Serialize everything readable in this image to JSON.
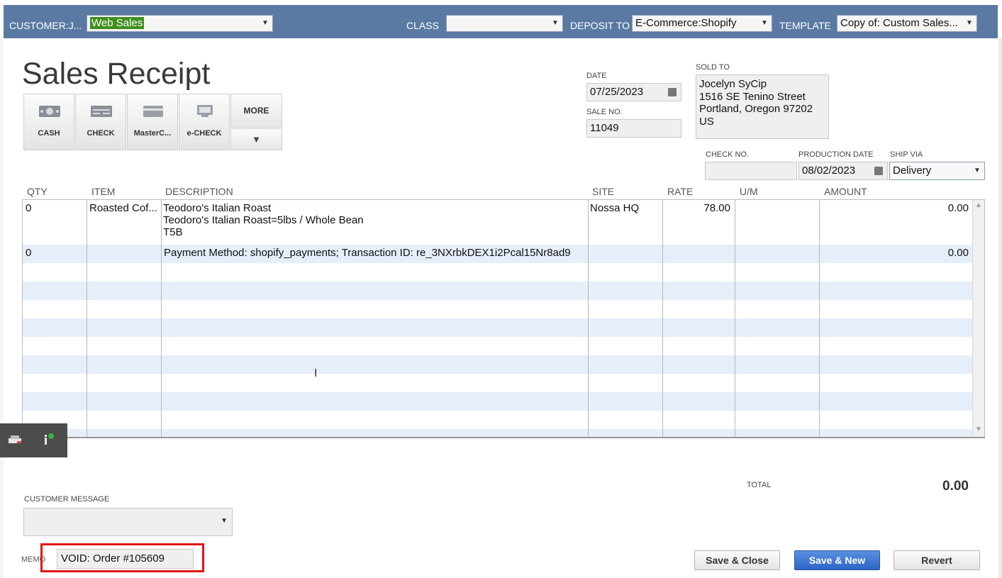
{
  "header": {
    "customer_label": "CUSTOMER:J...",
    "customer_value": "Web Sales",
    "class_label": "CLASS",
    "class_value": "",
    "deposit_label": "DEPOSIT TO",
    "deposit_value": "E-Commerce:Shopify",
    "template_label": "TEMPLATE",
    "template_value": "Copy of: Custom Sales..."
  },
  "form": {
    "title": "Sales Receipt",
    "payment_methods": [
      "CASH",
      "CHECK",
      "MasterC...",
      "e-CHECK"
    ],
    "more_label": "MORE",
    "more_arrow": "▼",
    "date_label": "DATE",
    "date_value": "07/25/2023",
    "sale_no_label": "SALE NO.",
    "sale_no_value": "11049",
    "sold_to_label": "SOLD TO",
    "sold_to_lines": [
      "Jocelyn SyCip",
      "1516 SE Tenino Street",
      "Portland, Oregon 97202",
      "US"
    ],
    "check_no_label": "CHECK NO.",
    "check_no_value": "",
    "production_date_label": "PRODUCTION DATE",
    "production_date_value": "08/02/2023",
    "ship_via_label": "SHIP VIA",
    "ship_via_value": "Delivery"
  },
  "grid": {
    "columns": [
      "QTY",
      "ITEM",
      "DESCRIPTION",
      "SITE",
      "RATE",
      "U/M",
      "AMOUNT"
    ],
    "rows": [
      {
        "qty": "0",
        "item": "Roasted Cof...",
        "description": [
          "Teodoro's Italian Roast",
          "Teodoro's Italian Roast=5lbs / Whole Bean",
          "T5B"
        ],
        "site": "Nossa HQ",
        "rate": "78.00",
        "um": "",
        "amount": "0.00"
      },
      {
        "qty": "0",
        "item": "",
        "description": [
          "Payment Method: shopify_payments; Transaction ID: re_3NXrbkDEX1i2Pcal15Nr8ad9"
        ],
        "site": "",
        "rate": "",
        "um": "",
        "amount": "0.00"
      }
    ]
  },
  "footer": {
    "total_label": "TOTAL",
    "total_value": "0.00",
    "customer_message_label": "CUSTOMER MESSAGE",
    "customer_message_value": "",
    "memo_label": "MEMO",
    "memo_value": "VOID: Order  #105609",
    "save_close_label": "Save & Close",
    "save_new_label": "Save & New",
    "revert_label": "Revert"
  },
  "colors": {
    "header_bar": "#5a7aa3",
    "row_stripe": "#e6eefa",
    "memo_highlight": "#e01515",
    "primary_button": "#2d66c5"
  },
  "icons": [
    "cash-icon",
    "check-icon",
    "credit-card-icon",
    "echeck-icon",
    "calendar-icon",
    "dropdown-arrow-icon"
  ]
}
